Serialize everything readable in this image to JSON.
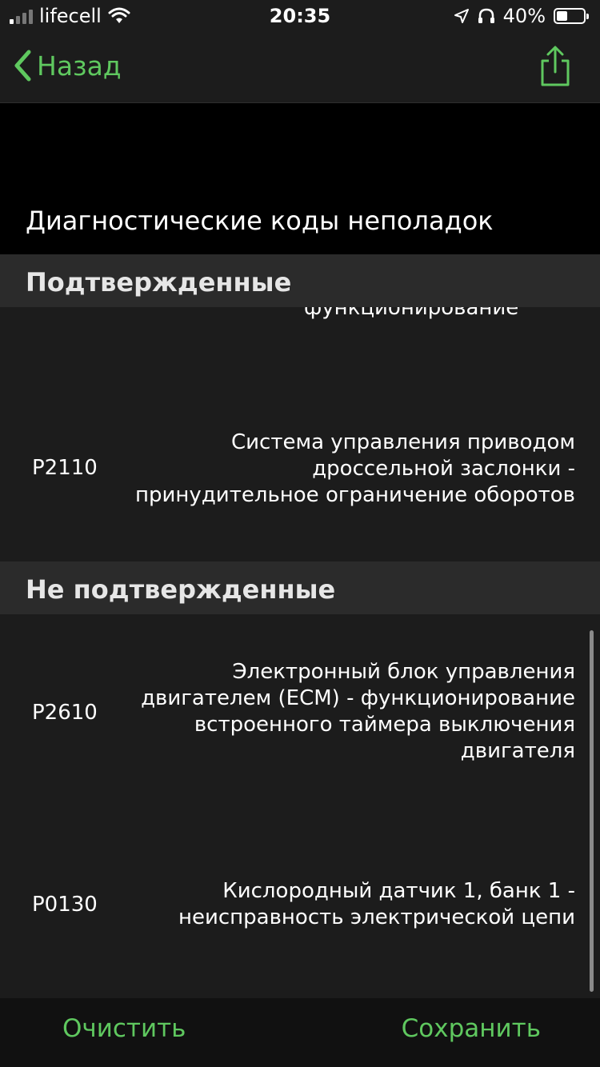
{
  "status_bar": {
    "carrier": "lifecell",
    "time": "20:35",
    "battery": "40%",
    "battery_level": 0.4
  },
  "nav": {
    "back_label": "Назад"
  },
  "page": {
    "title": "Диагностические коды неполадок"
  },
  "sections": {
    "confirmed": {
      "label": "Подтвержденные",
      "partial_text": "функционирование",
      "rows": [
        {
          "code": "P2110",
          "desc": "Система управления приводом дроссельной заслонки - принудительное ограничение оборотов"
        }
      ]
    },
    "unconfirmed": {
      "label": "Не подтвержденные",
      "rows": [
        {
          "code": "P2610",
          "desc": "Электронный блок управления двигателем (ECM) - функционирование встроенного таймера выключения двигателя"
        },
        {
          "code": "P0130",
          "desc": "Кислородный датчик 1, банк 1 - неисправность электрической цепи"
        }
      ]
    }
  },
  "toolbar": {
    "clear_label": "Очистить",
    "save_label": "Сохранить"
  },
  "colors": {
    "accent": "#5fc85f",
    "background": "#1c1c1c",
    "section_header": "#2b2b2b"
  }
}
